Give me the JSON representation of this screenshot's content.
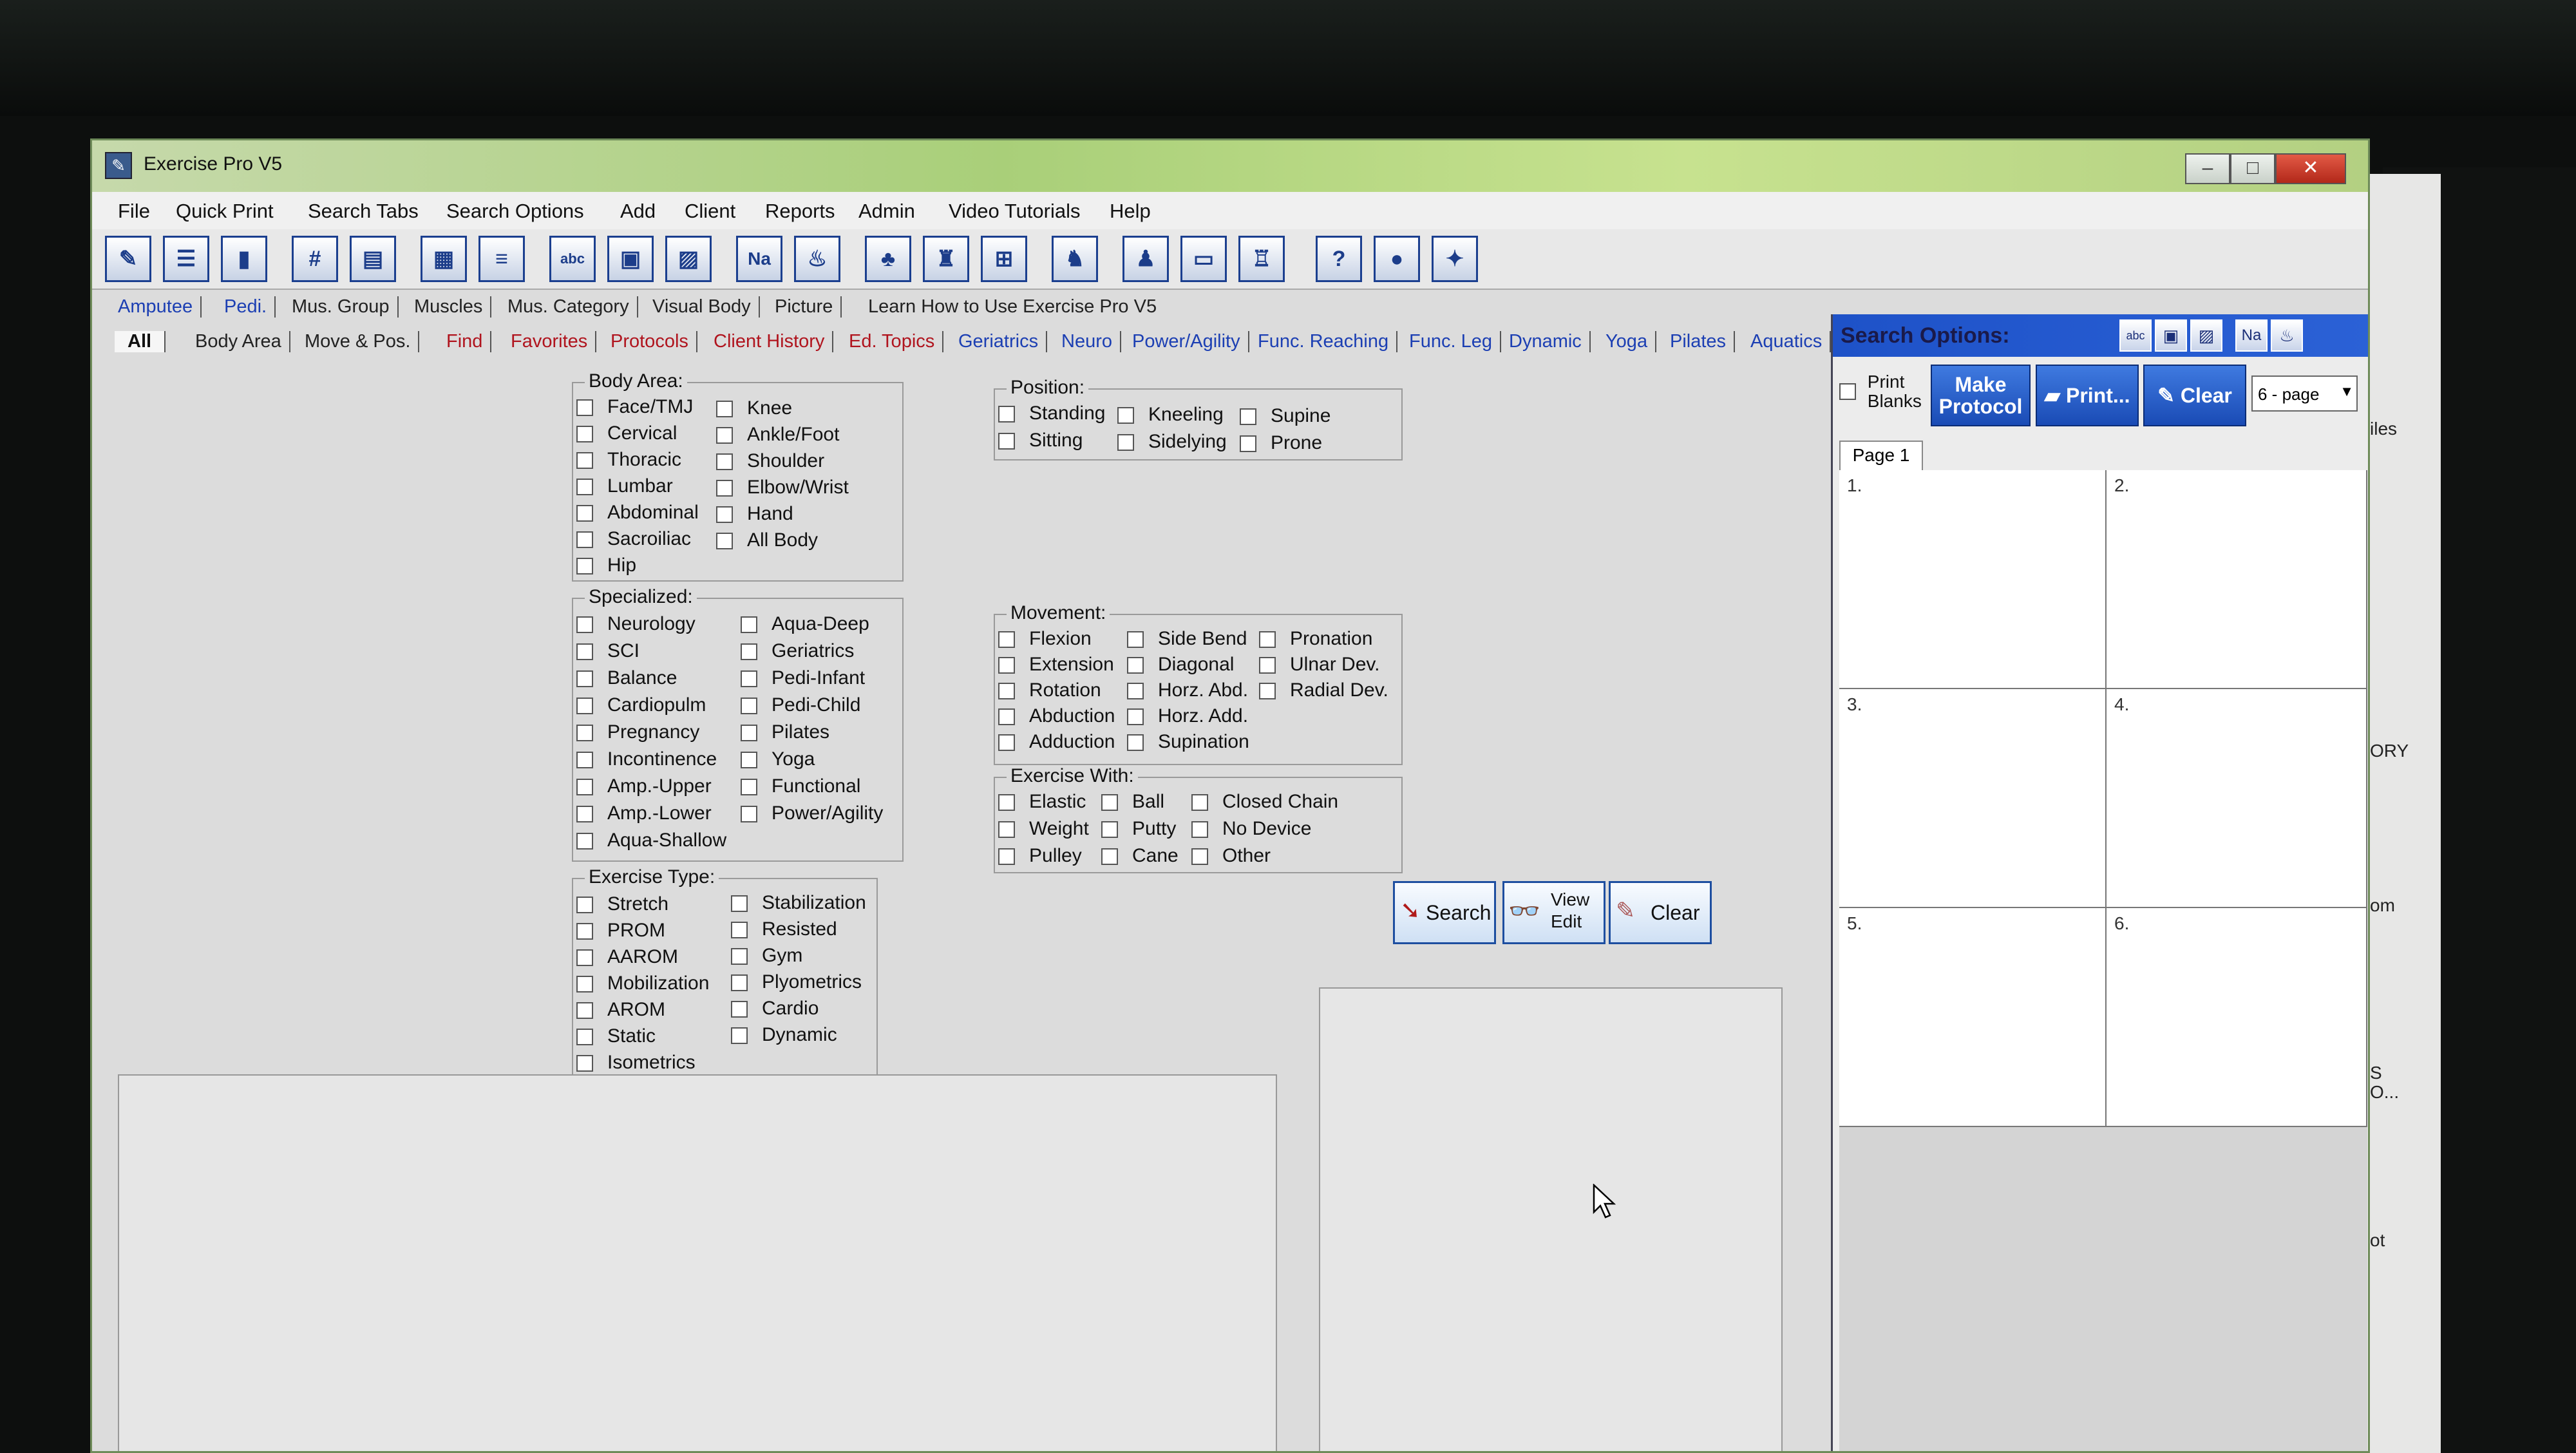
{
  "window": {
    "title": "Exercise Pro V5",
    "min": "–",
    "max": "□",
    "close": "✕"
  },
  "menu": [
    "File",
    "Quick Print",
    "Search Tabs",
    "Search Options",
    "Add",
    "Client",
    "Reports",
    "Admin",
    "Video Tutorials",
    "Help"
  ],
  "toolbar": {
    "hash": "#",
    "abc": "abc",
    "na": "Na",
    "help": "?"
  },
  "tabs_row1": [
    "Amputee",
    "Pedi.",
    "Mus. Group",
    "Muscles",
    "Mus. Category",
    "Visual Body",
    "Picture",
    "Learn How to Use Exercise Pro V5"
  ],
  "tabs_row2": [
    "All",
    "Body Area",
    "Move & Pos.",
    "Find",
    "Favorites",
    "Protocols",
    "Client History",
    "Ed. Topics",
    "Geriatrics",
    "Neuro",
    "Power/Agility",
    "Func. Reaching",
    "Func. Leg",
    "Dynamic",
    "Yoga",
    "Pilates",
    "Aquatics"
  ],
  "body_area": {
    "title": "Body Area:",
    "col1": [
      "Face/TMJ",
      "Cervical",
      "Thoracic",
      "Lumbar",
      "Abdominal",
      "Sacroiliac",
      "Hip"
    ],
    "col2": [
      "Knee",
      "Ankle/Foot",
      "Shoulder",
      "Elbow/Wrist",
      "Hand",
      "All Body"
    ]
  },
  "specialized": {
    "title": "Specialized:",
    "col1": [
      "Neurology",
      "SCI",
      "Balance",
      "Cardiopulm",
      "Pregnancy",
      "Incontinence",
      "Amp.-Upper",
      "Amp.-Lower",
      "Aqua-Shallow"
    ],
    "col2": [
      "Aqua-Deep",
      "Geriatrics",
      "Pedi-Infant",
      "Pedi-Child",
      "Pilates",
      "Yoga",
      "Functional",
      "Power/Agility"
    ]
  },
  "exercise_type": {
    "title": "Exercise Type:",
    "col1": [
      "Stretch",
      "PROM",
      "AAROM",
      "Mobilization",
      "AROM",
      "Static",
      "Isometrics"
    ],
    "col2": [
      "Stabilization",
      "Resisted",
      "Gym",
      "Plyometrics",
      "Cardio",
      "Dynamic"
    ]
  },
  "position": {
    "title": "Position:",
    "col1": [
      "Standing",
      "Sitting"
    ],
    "col2": [
      "Kneeling",
      "Sidelying"
    ],
    "col3": [
      "Supine",
      "Prone"
    ]
  },
  "movement": {
    "title": "Movement:",
    "col1": [
      "Flexion",
      "Extension",
      "Rotation",
      "Abduction",
      "Adduction"
    ],
    "col2": [
      "Side Bend",
      "Diagonal",
      "Horz. Abd.",
      "Horz. Add.",
      "Supination"
    ],
    "col3": [
      "Pronation",
      "Ulnar Dev.",
      "Radial Dev."
    ]
  },
  "exercise_with": {
    "title": "Exercise With:",
    "col1": [
      "Elastic",
      "Weight",
      "Pulley"
    ],
    "col2": [
      "Ball",
      "Putty",
      "Cane"
    ],
    "col3": [
      "Closed Chain",
      "No Device",
      "Other"
    ]
  },
  "actions": {
    "search": "Search",
    "view_edit_1": "View",
    "view_edit_2": "Edit",
    "clear": "Clear"
  },
  "search_options": {
    "title": "Search Options:",
    "print_blanks_1": "Print",
    "print_blanks_2": "Blanks",
    "make_protocol_1": "Make",
    "make_protocol_2": "Protocol",
    "print": "Print...",
    "clear": "Clear",
    "page_select": "6 - page",
    "page_tab": "Page 1",
    "cells": [
      "1.",
      "2.",
      "3.",
      "4.",
      "5.",
      "6."
    ]
  },
  "background_text": [
    "iles",
    "ORY",
    "om",
    "S",
    "O...",
    "ot"
  ]
}
